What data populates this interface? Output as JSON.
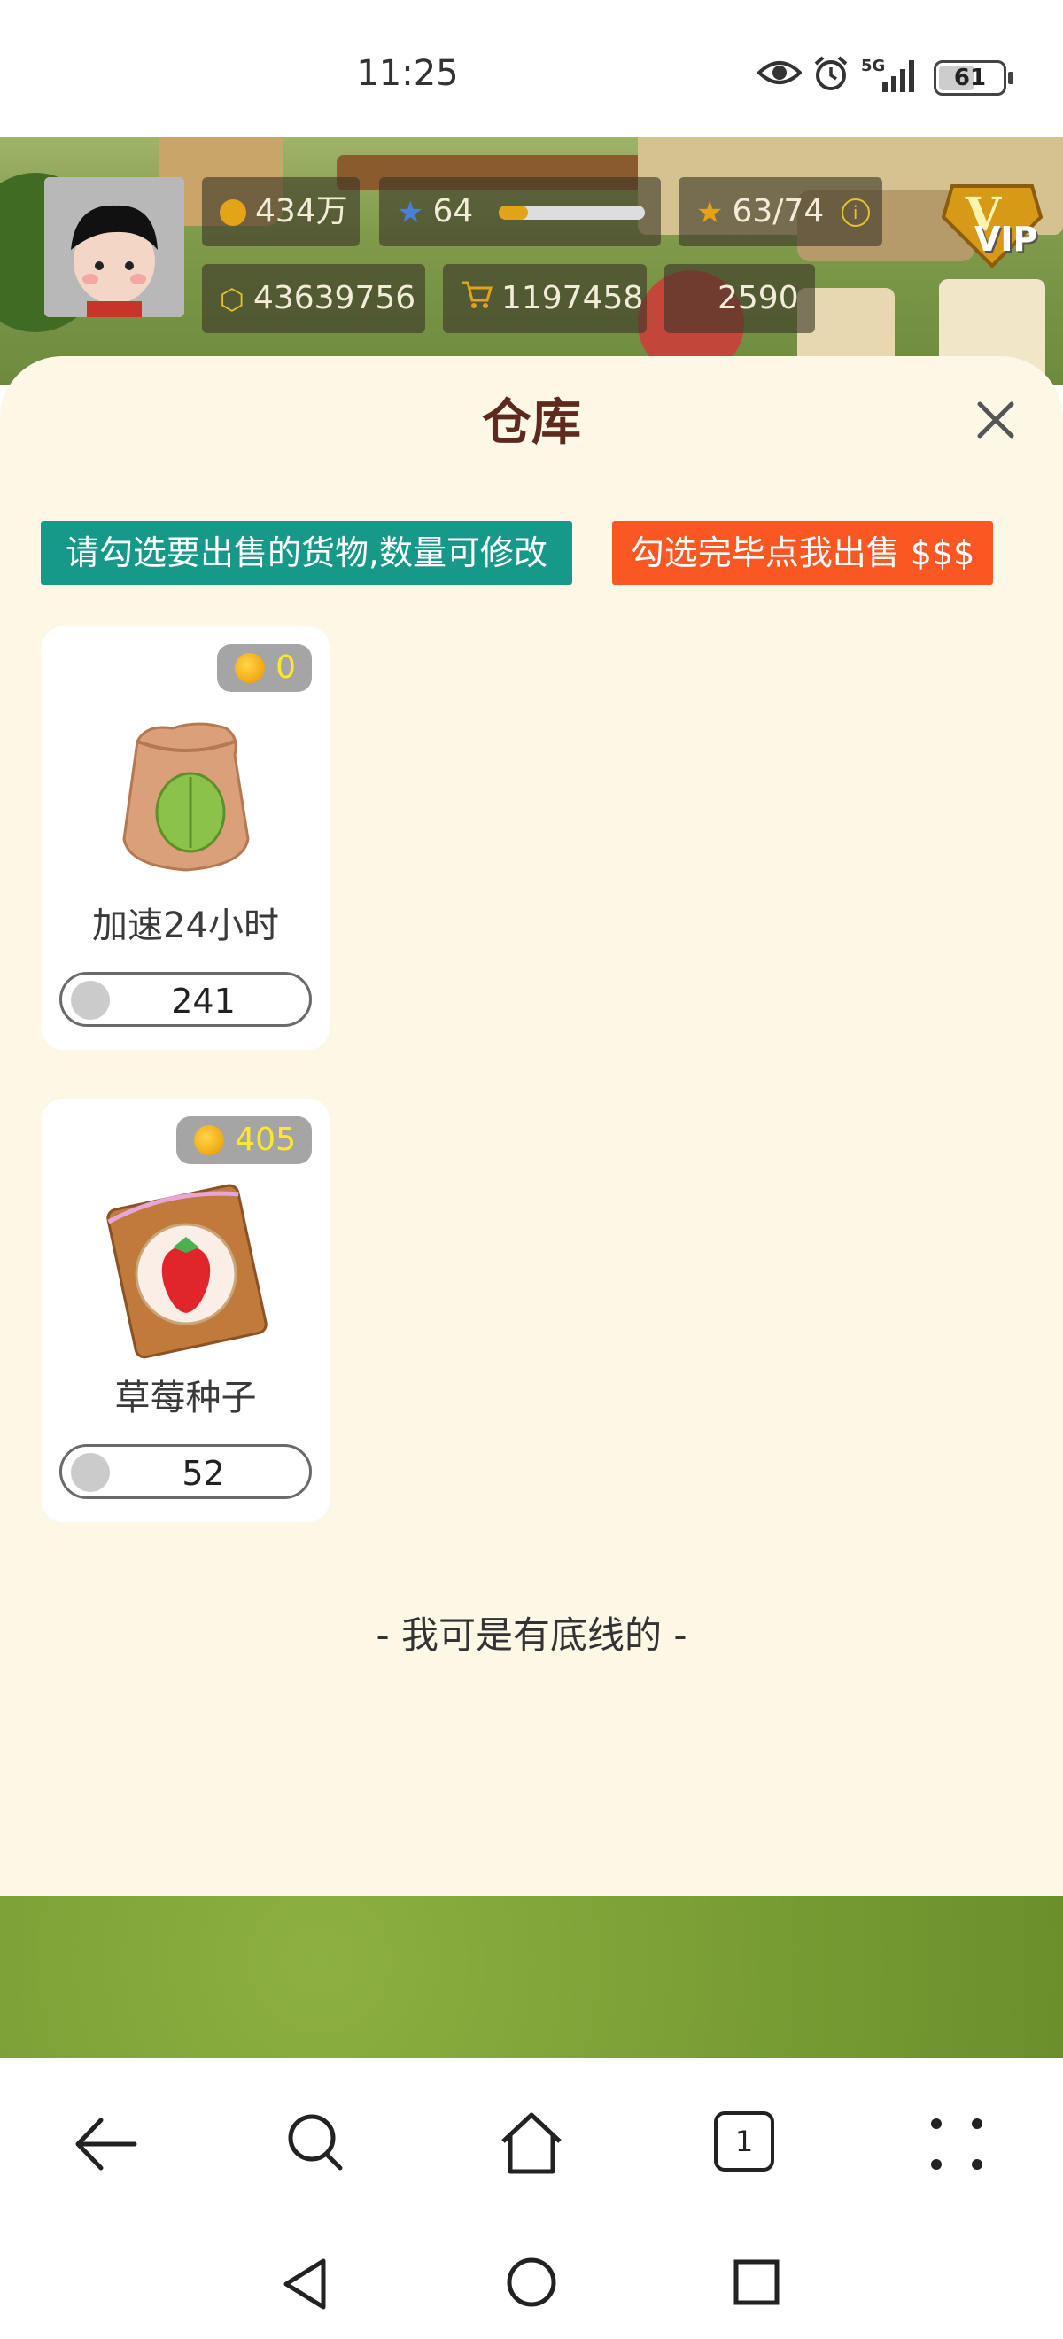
{
  "status_bar": {
    "time": "11:25",
    "network": "5G",
    "battery": "61"
  },
  "hud": {
    "coins": "434万",
    "level": "64",
    "xp_fraction": 0.2,
    "stars": "63/74",
    "cubes": "43639756",
    "cart": "1197458",
    "other": "2590",
    "vip_label": "VIP"
  },
  "panel": {
    "title": "仓库",
    "hint_label": "请勾选要出售的货物,数量可修改",
    "sell_label": "勾选完毕点我出售 $$$",
    "items": [
      {
        "name": "加速24小时",
        "price": "0",
        "quantity": "241",
        "icon": "seed-bag-leaf-icon"
      },
      {
        "name": "草莓种子",
        "price": "405",
        "quantity": "52",
        "icon": "strawberry-seed-pack-icon"
      }
    ],
    "footer": "- 我可是有底线的 -"
  },
  "browser_nav": {
    "tabs_count": "1"
  },
  "colors": {
    "panel_bg": "#fdf7e6",
    "title": "#5e2a1e",
    "hint_bg": "#17998a",
    "sell_bg": "#fb5722",
    "price_text": "#ffe82a"
  }
}
